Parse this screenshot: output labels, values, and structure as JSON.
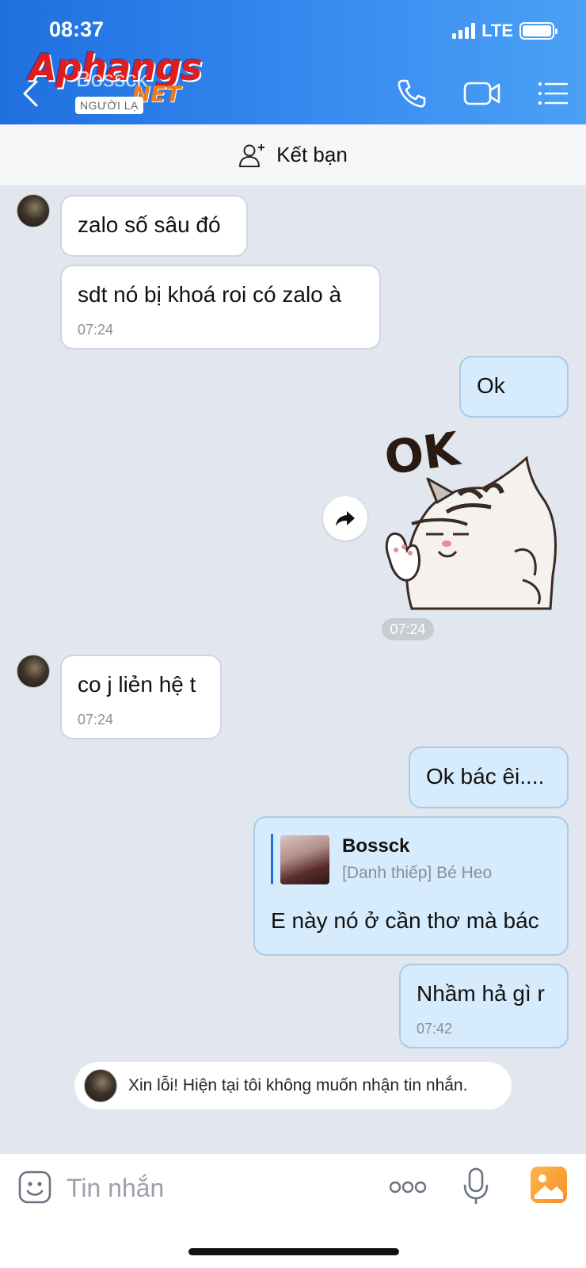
{
  "status_bar": {
    "time": "08:37",
    "network": "LTE"
  },
  "watermark": {
    "main": "Aphangs",
    "suffix": ".NET"
  },
  "header": {
    "contact_name": "Bossck",
    "stranger_label": "NGƯỜI LẠ"
  },
  "friend_bar": {
    "label": "Kết bạn"
  },
  "messages": [
    {
      "text": "zalo số sâu đó"
    },
    {
      "text": "sdt nó bị khoá roi có zalo à",
      "time": "07:24"
    },
    {
      "text": "Ok"
    },
    {
      "sticker_text": "OK",
      "time": "07:24"
    },
    {
      "text": "co j liẻn hệ t",
      "time": "07:24"
    },
    {
      "text": "Ok bác êi...."
    },
    {
      "quote_name": "Bossck",
      "quote_sub": "[Danh thiếp] Bé Heo",
      "text": "E này nó ở cần thơ mà bác"
    },
    {
      "text": "Nhầm hả gì r",
      "time": "07:42"
    }
  ],
  "notice": {
    "text": "Xin lỗi! Hiện tại tôi không muốn nhận tin nhắn."
  },
  "composer": {
    "placeholder": "Tin nhắn"
  },
  "colors": {
    "header_start": "#1f6fe0",
    "header_end": "#4aa0f5",
    "bubble_out": "#d6ebfb",
    "bubble_in": "#ffffff",
    "chat_bg": "#e2e6ee"
  },
  "icons": [
    "back-icon",
    "phone-icon",
    "video-icon",
    "menu-list-icon",
    "add-friend-icon",
    "share-forward-icon",
    "emoji-icon",
    "more-icon",
    "mic-icon",
    "photo-icon"
  ]
}
